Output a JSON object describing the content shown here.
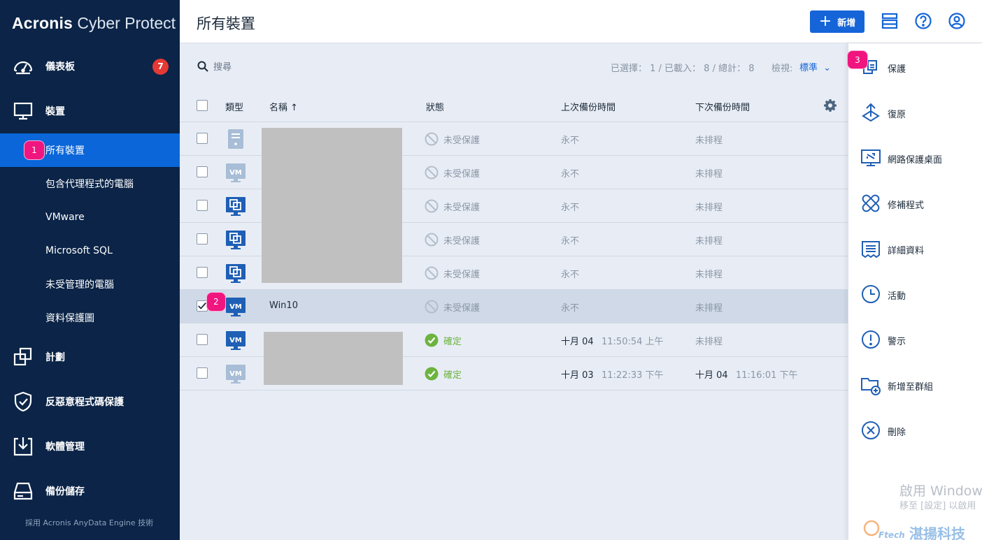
{
  "app": {
    "brand_bold": "Acronis",
    "brand_rest": " Cyber Protect",
    "footer_note": "採用 Acronis AnyData Engine 技術"
  },
  "sidebar": {
    "dashboard": {
      "label": "儀表板",
      "badge": "7",
      "icon": "dashboard-gauge-icon"
    },
    "devices": {
      "label": "裝置",
      "icon": "monitor-icon"
    },
    "device_groups": [
      {
        "label": "所有裝置",
        "active": true
      },
      {
        "label": "包含代理程式的電腦"
      },
      {
        "label": "VMware"
      },
      {
        "label": "Microsoft SQL"
      },
      {
        "label": "未受管理的電腦"
      },
      {
        "label": "資料保護圖"
      }
    ],
    "plans": {
      "label": "計劃",
      "icon": "plans-icon"
    },
    "antimalware": {
      "label": "反惡意程式碼保護",
      "icon": "shield-icon"
    },
    "software": {
      "label": "軟體管理",
      "icon": "software-download-icon"
    },
    "storage": {
      "label": "備份儲存",
      "icon": "storage-drive-icon"
    }
  },
  "header": {
    "title": "所有裝置",
    "add_label": "新增"
  },
  "toolbar": {
    "search_placeholder": "搜尋",
    "stats": "已選擇： 1 / 已載入： 8 / 總計： 8",
    "view_label": "檢視:",
    "view_value": "標準"
  },
  "table": {
    "columns": {
      "type": "類型",
      "name": "名稱 ↑",
      "status": "狀態",
      "last_backup": "上次備份時間",
      "next_backup": "下次備份時間"
    },
    "rows": [
      {
        "type": "server",
        "name": "",
        "status": "未受保護",
        "status_kind": "unprotected",
        "last_date": "永不",
        "last_time": "",
        "next_date": "未排程",
        "next_time": "",
        "selected": false,
        "dim": true
      },
      {
        "type": "vm-faded",
        "name": "",
        "status": "未受保護",
        "status_kind": "unprotected",
        "last_date": "永不",
        "last_time": "",
        "next_date": "未排程",
        "next_time": "",
        "selected": false,
        "dim": true
      },
      {
        "type": "workstation",
        "name": "",
        "status": "未受保護",
        "status_kind": "unprotected",
        "last_date": "永不",
        "last_time": "",
        "next_date": "未排程",
        "next_time": "",
        "selected": false,
        "dim": true
      },
      {
        "type": "workstation",
        "name": "",
        "status": "未受保護",
        "status_kind": "unprotected",
        "last_date": "永不",
        "last_time": "",
        "next_date": "未排程",
        "next_time": "",
        "selected": false,
        "dim": true
      },
      {
        "type": "workstation",
        "name": "",
        "status": "未受保護",
        "status_kind": "unprotected",
        "last_date": "永不",
        "last_time": "",
        "next_date": "未排程",
        "next_time": "",
        "selected": false,
        "dim": true
      },
      {
        "type": "vm",
        "name": "Win10",
        "status": "未受保護",
        "status_kind": "unprotected",
        "last_date": "永不",
        "last_time": "",
        "next_date": "未排程",
        "next_time": "",
        "selected": true,
        "dim": true
      },
      {
        "type": "vm",
        "name": "",
        "status": "確定",
        "status_kind": "ok",
        "last_date": "十月 04",
        "last_time": "11:50:54 上午",
        "next_date": "未排程",
        "next_time": "",
        "selected": false,
        "dim": false
      },
      {
        "type": "vm-faded",
        "name": "",
        "status": "確定",
        "status_kind": "ok",
        "last_date": "十月 03",
        "last_time": "11:22:33 下午",
        "next_date": "十月 04",
        "next_time": "11:16:01 下午",
        "selected": false,
        "dim": false
      }
    ]
  },
  "actions": [
    {
      "label": "保護",
      "icon": "protect-icon"
    },
    {
      "label": "復原",
      "icon": "recover-icon"
    },
    {
      "label": "網路保護桌面",
      "icon": "remote-desktop-icon"
    },
    {
      "label": "修補程式",
      "icon": "patch-icon"
    },
    {
      "label": "詳細資料",
      "icon": "details-icon"
    },
    {
      "label": "活動",
      "icon": "activities-clock-icon"
    },
    {
      "label": "警示",
      "icon": "alert-icon"
    },
    {
      "label": "新增至群組",
      "icon": "add-to-group-icon"
    },
    {
      "label": "刪除",
      "icon": "delete-icon"
    }
  ],
  "watermark": {
    "line1": "啟用 Windows",
    "line2": "移至 [設定] 以啟用",
    "brand": "湛揚科技",
    "brand_mark": "Ftech"
  },
  "markers": [
    "1",
    "2",
    "3"
  ],
  "colors": {
    "sidebar": "#0b2447",
    "accent": "#1565d8",
    "active_item": "#0a66d9",
    "badge": "#e53935",
    "marker": "#f0157f",
    "ok": "#6db33f"
  }
}
